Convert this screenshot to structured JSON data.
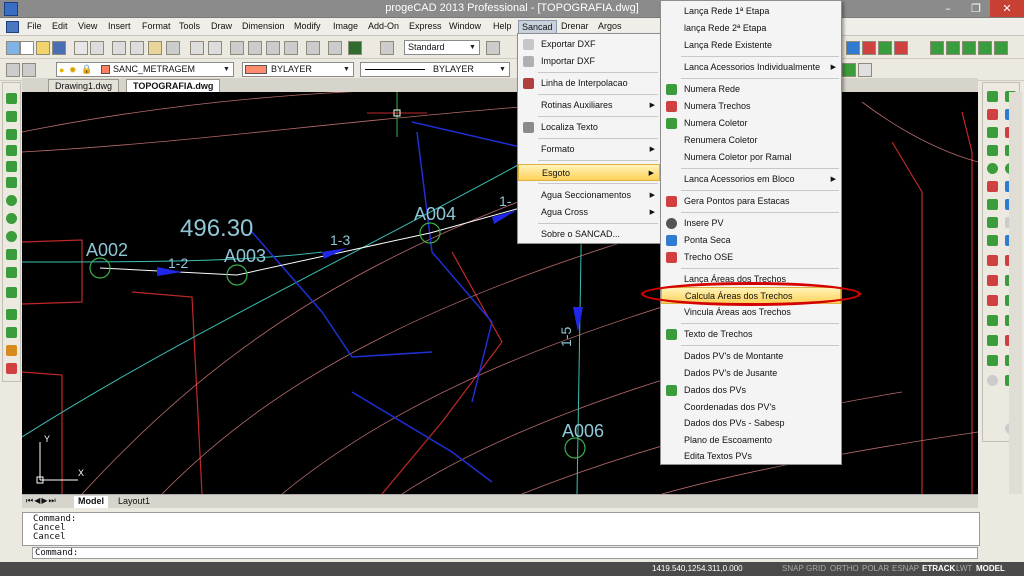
{
  "window": {
    "title": "progeCAD 2013 Professional - [TOPOGRAFIA.dwg]",
    "min": "–",
    "max": "❐",
    "close": "✕"
  },
  "menubar": [
    "File",
    "Edit",
    "View",
    "Insert",
    "Format",
    "Tools",
    "Draw",
    "Dimension",
    "Modify",
    "Image",
    "Add-On",
    "Express",
    "Window",
    "Help",
    "Sancad",
    "Drenar",
    "Argos"
  ],
  "toolbar": {
    "text_style": "Standard",
    "layer": "SANC_METRAGEM",
    "color": "BYLAYER",
    "linetype": "BYLAYER",
    "layer_swatch": "#ff8c6e"
  },
  "doc_tabs": [
    "Drawing1.dwg",
    "TOPOGRAFIA.dwg"
  ],
  "layout_tabs": [
    "Model",
    "Layout1"
  ],
  "canvas": {
    "labels": {
      "value": "496.30",
      "a002": "A002",
      "a003": "A003",
      "a004": "A004",
      "a006": "A006",
      "s12": "1-2",
      "s13": "1-3",
      "s15": "1-5",
      "s1partial": "1-",
      "axis_y": "Y",
      "axis_x": "X"
    }
  },
  "sancad_menu": [
    {
      "label": "Exportar DXF",
      "icon": "export-dxf-icon"
    },
    {
      "label": "Importar DXF",
      "icon": "import-dxf-icon"
    },
    {
      "label": "Linha de Interpolacao",
      "icon": "interpolation-line-icon"
    },
    {
      "label": "Rotinas Auxiliares",
      "submenu": true
    },
    {
      "label": "Localiza Texto",
      "icon": "find-text-icon"
    },
    {
      "label": "Formato",
      "submenu": true
    },
    {
      "label": "Esgoto",
      "submenu": true,
      "highlighted": true
    },
    {
      "label": "Agua Seccionamentos",
      "submenu": true
    },
    {
      "label": "Agua Cross",
      "submenu": true
    },
    {
      "label": "Sobre o SANCAD..."
    }
  ],
  "esgoto_menu": [
    {
      "label": "Lança Rede 1ª Etapa"
    },
    {
      "label": "lança Rede 2ª Etapa"
    },
    {
      "label": "Lança Rede Existente"
    },
    {
      "label": "Lanca Acessorios Individualmente",
      "submenu": true
    },
    {
      "label": "Numera Rede",
      "icon": "numbering-icon"
    },
    {
      "label": "Numera Trechos",
      "icon": "numbering-icon"
    },
    {
      "label": "Numera Coletor",
      "icon": "numbering-icon"
    },
    {
      "label": "Renumera Coletor"
    },
    {
      "label": "Numera Coletor por Ramal"
    },
    {
      "label": "Lanca Acessorios em Bloco",
      "submenu": true
    },
    {
      "label": "Gera Pontos para Estacas",
      "icon": "stake-points-icon"
    },
    {
      "label": "Insere PV",
      "icon": "insert-pv-icon"
    },
    {
      "label": "Ponta Seca",
      "icon": "dry-end-icon"
    },
    {
      "label": "Trecho OSE",
      "icon": "segment-ose-icon"
    },
    {
      "label": "Lança Áreas dos Trechos"
    },
    {
      "label": "Calcula Áreas dos Trechos",
      "highlighted": true
    },
    {
      "label": "Vincula Áreas aos Trechos"
    },
    {
      "label": "Texto de Trechos",
      "icon": "text-segments-icon"
    },
    {
      "label": "Dados PV's de Montante"
    },
    {
      "label": "Dados PV's de Jusante"
    },
    {
      "label": "Dados dos PVs",
      "icon": "pv-data-icon"
    },
    {
      "label": "Coordenadas dos PV's"
    },
    {
      "label": "Dados dos PVs - Sabesp"
    },
    {
      "label": "Plano de Escoamento"
    },
    {
      "label": "Edita Textos PVs"
    }
  ],
  "command": {
    "history": [
      "Command:",
      "Cancel",
      "Cancel"
    ],
    "prompt": "Command:"
  },
  "status": {
    "coords": "1419.540,1254.311,0.000",
    "toggles": [
      "SNAP",
      "GRID",
      "ORTHO",
      "POLAR",
      "ESNAP",
      "ETRACK",
      "LWT",
      "MODEL"
    ]
  }
}
